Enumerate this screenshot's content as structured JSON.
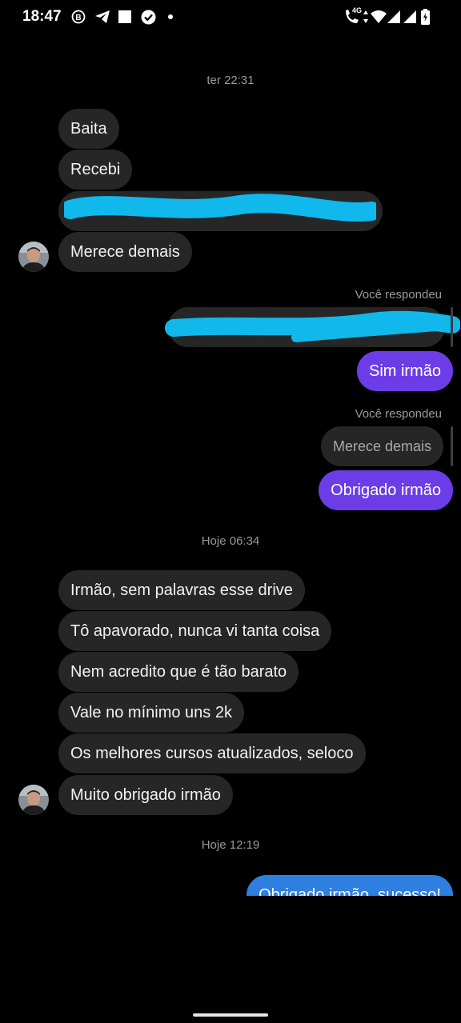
{
  "status_bar": {
    "time": "18:47",
    "network_label": "4G",
    "icons": [
      "b-circle-icon",
      "telegram-icon",
      "square-icon",
      "check-circle-icon",
      "dot-icon",
      "wifi-call-icon",
      "data-arrows-icon",
      "wifi-icon",
      "signal-icon",
      "signal-icon",
      "battery-icon"
    ]
  },
  "chat": {
    "timestamps": {
      "first": "ter 22:31",
      "second": "Hoje 06:34",
      "third": "Hoje 12:19"
    },
    "group1": [
      "Baita",
      "Recebi",
      "",
      "Merece demais"
    ],
    "reply1": {
      "label": "Você respondeu",
      "quoted": "",
      "message": "Sim irmão"
    },
    "reply2": {
      "label": "Você respondeu",
      "quoted": "Merece demais",
      "message": "Obrigado irmão"
    },
    "group2": [
      "Irmão, sem palavras esse drive",
      "Tô apavorado, nunca vi tanta coisa",
      "Nem acredito que é tão barato",
      "Vale no mínimo uns 2k",
      "Os melhores cursos atualizados, seloco",
      "Muito obrigado irmão"
    ],
    "last_sent": "Obrigado irmão, sucesso!"
  },
  "colors": {
    "background": "#000000",
    "received_bubble": "#262626",
    "sent_bubble": "#6c3de6",
    "sent_bubble_blue": "#2f7fe0",
    "redaction": "#10b8ec"
  }
}
